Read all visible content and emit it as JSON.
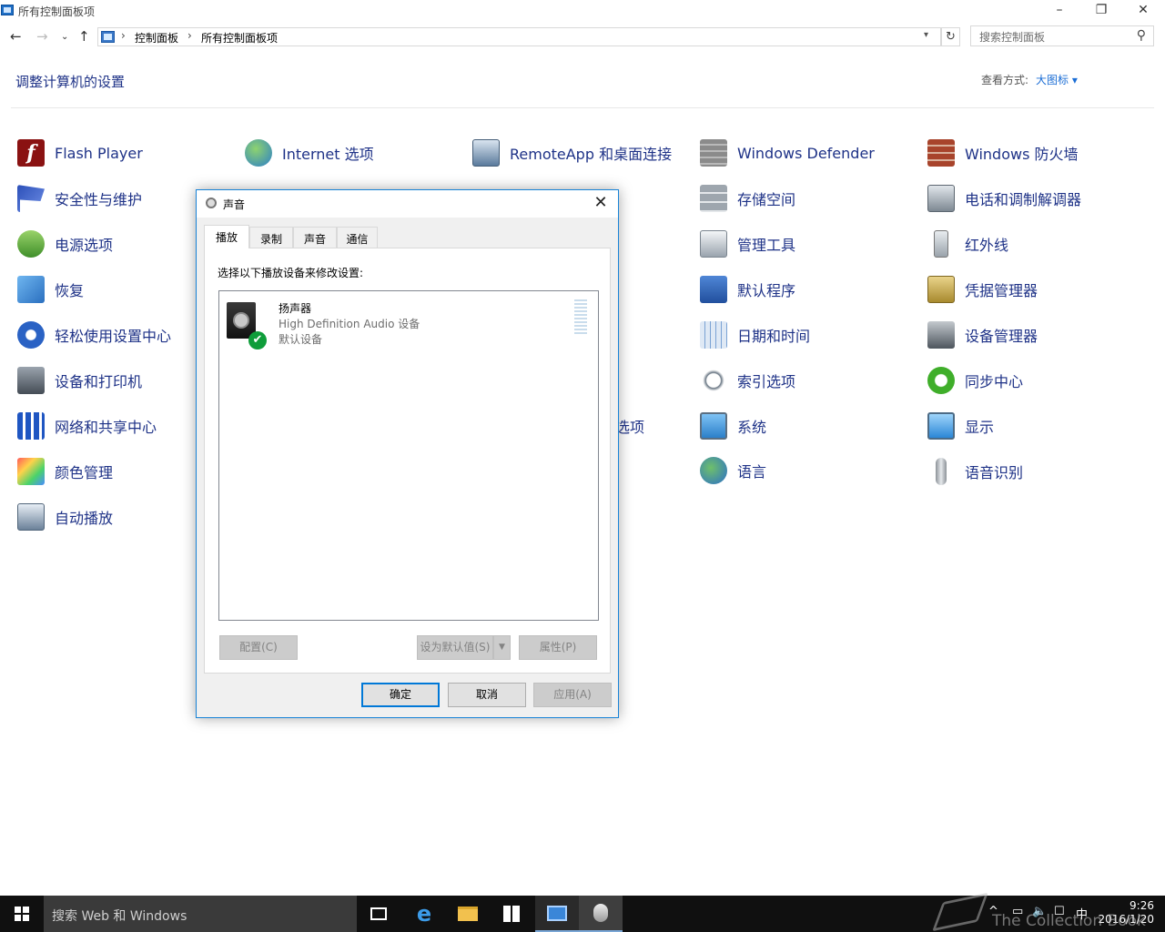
{
  "window": {
    "title": "所有控制面板项"
  },
  "address": {
    "breadcrumbs": [
      "控制面板",
      "所有控制面板项"
    ],
    "search_placeholder": "搜索控制面板"
  },
  "header": {
    "heading": "调整计算机的设置",
    "view_by_label": "查看方式:",
    "view_by_value": "大图标"
  },
  "items": {
    "col1": [
      "Flash Player",
      "安全性与维护",
      "电源选项",
      "恢复",
      "轻松使用设置中心",
      "设备和打印机",
      "网络和共享中心",
      "颜色管理",
      "自动播放"
    ],
    "col2": [
      "Internet 选项"
    ],
    "col3": [
      "RemoteApp 和桌面连接",
      "选项"
    ],
    "col4": [
      "Windows Defender",
      "存储空间",
      "管理工具",
      "默认程序",
      "日期和时间",
      "索引选项",
      "系统",
      "语言"
    ],
    "col5": [
      "Windows 防火墙",
      "电话和调制解调器",
      "红外线",
      "凭据管理器",
      "设备管理器",
      "同步中心",
      "显示",
      "语音识别"
    ]
  },
  "dialog": {
    "title": "声音",
    "tabs": [
      "播放",
      "录制",
      "声音",
      "通信"
    ],
    "instruction": "选择以下播放设备来修改设置:",
    "device": {
      "name": "扬声器",
      "description": "High Definition Audio 设备",
      "status": "默认设备"
    },
    "buttons": {
      "configure": "配置(C)",
      "set_default": "设为默认值(S)",
      "properties": "属性(P)",
      "ok": "确定",
      "cancel": "取消",
      "apply": "应用(A)"
    }
  },
  "taskbar": {
    "search_text": "搜索 Web 和 Windows",
    "time": "9:26",
    "date": "2016/1/20",
    "ime": "中"
  },
  "watermark": "The Collection Book",
  "colors": {
    "link": "#1e3287",
    "accent": "#0078d7",
    "taskbar": "#101010"
  }
}
